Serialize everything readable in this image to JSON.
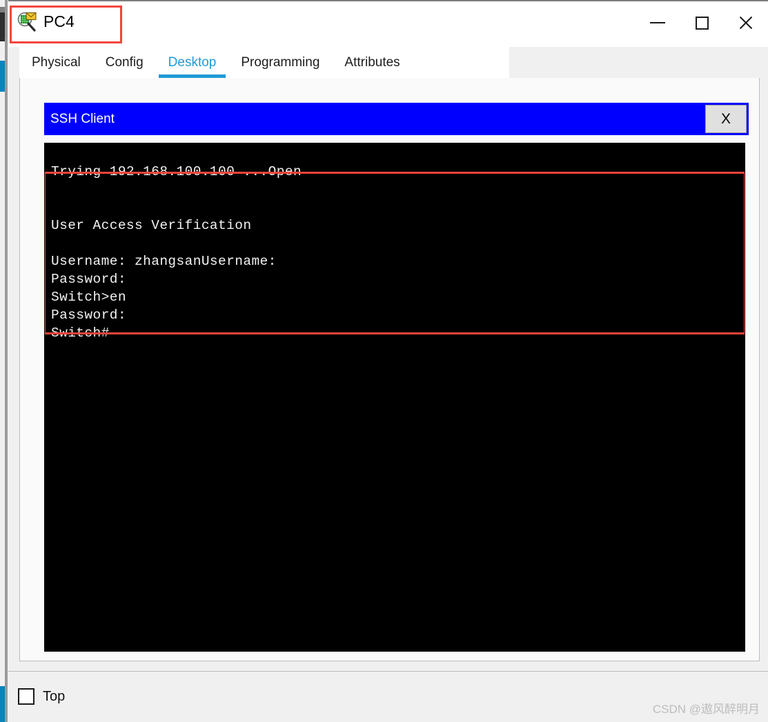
{
  "window": {
    "title": "PC4",
    "icon": "packet-tracer-inspect-icon",
    "controls": {
      "minimize": "—",
      "maximize": "□",
      "close": "✕"
    },
    "title_highlight_color": "#f4443c"
  },
  "tabs": [
    {
      "label": "Physical",
      "active": false
    },
    {
      "label": "Config",
      "active": false
    },
    {
      "label": "Desktop",
      "active": true
    },
    {
      "label": "Programming",
      "active": false
    },
    {
      "label": "Attributes",
      "active": false
    }
  ],
  "ssh_client": {
    "title": "SSH Client",
    "titlebar_color": "#0000ff",
    "close_label": "X",
    "terminal": {
      "background": "#000000",
      "foreground": "#f2f2f2",
      "lines": [
        "Trying 192.168.100.100 ...Open",
        "",
        "",
        "User Access Verification",
        "",
        "Username: zhangsanUsername:",
        "Password:",
        "Switch>en",
        "Password:",
        "Switch#"
      ],
      "text": "Trying 192.168.100.100 ...Open\n\n\nUser Access Verification\n\nUsername: zhangsanUsername:\nPassword:\nSwitch>en\nPassword:\nSwitch#",
      "highlight_color": "#f4443c"
    }
  },
  "bottom": {
    "top_checkbox_label": "Top",
    "top_checkbox_checked": false
  },
  "watermark": "CSDN @遨风醉明月"
}
